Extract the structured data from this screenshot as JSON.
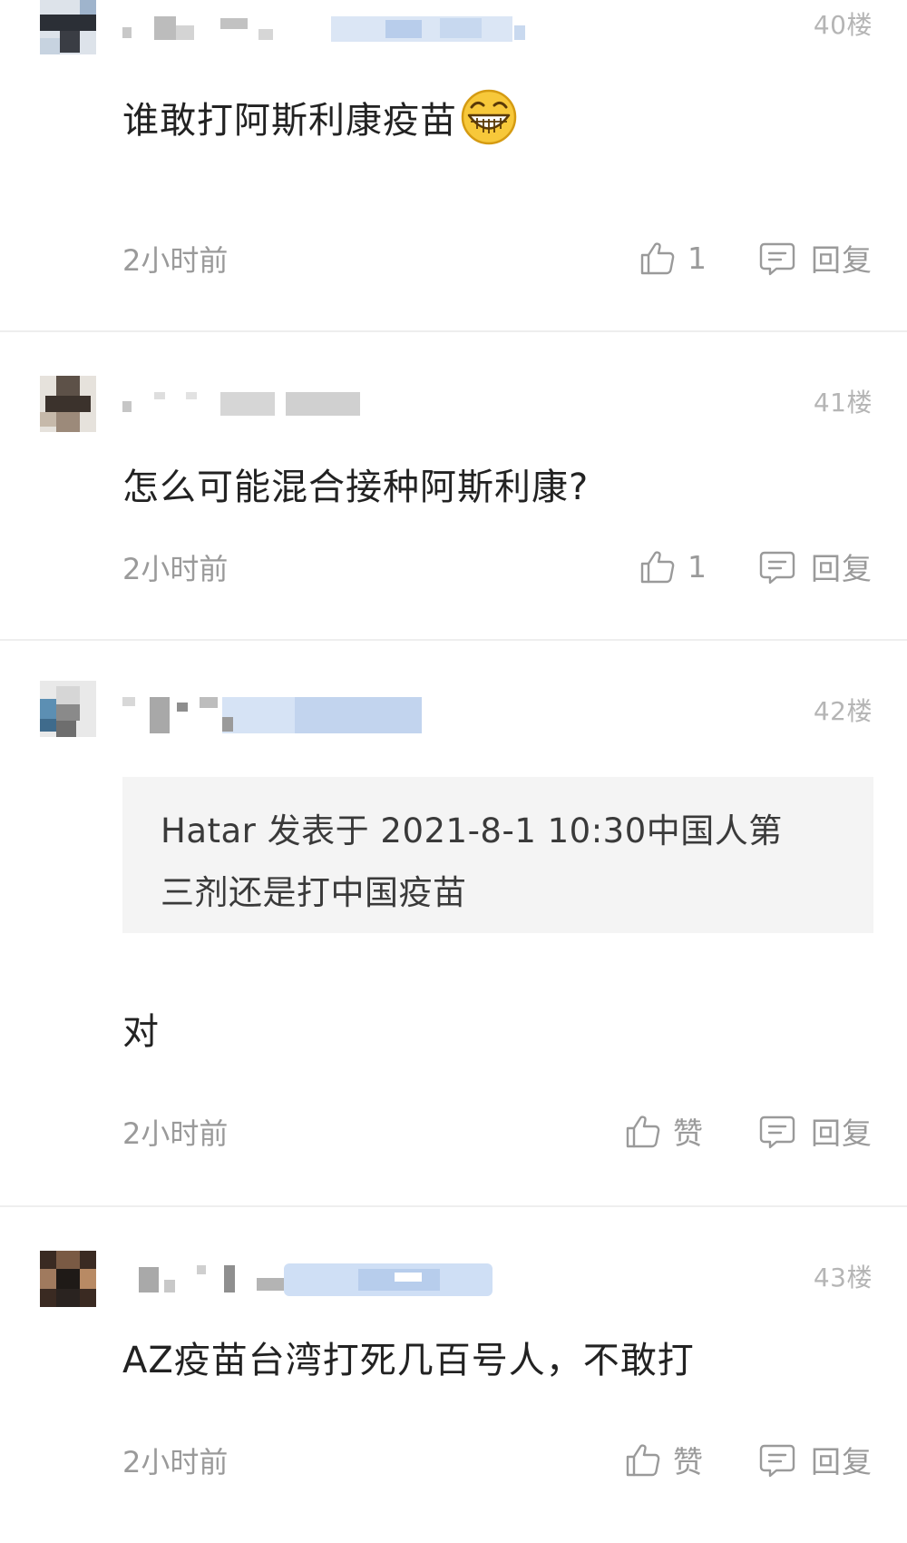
{
  "comments": [
    {
      "floor": "40楼",
      "text": "谁敢打阿斯利康疫苗",
      "emoji": "grinning-face-emoji",
      "time": "2小时前",
      "likes": "1",
      "reply_label": "回复"
    },
    {
      "floor": "41楼",
      "text": "怎么可能混合接种阿斯利康?",
      "time": "2小时前",
      "likes": "1",
      "reply_label": "回复"
    },
    {
      "floor": "42楼",
      "quote_line1": "Hatar 发表于 2021-8-1 10:30中国人第",
      "quote_line2": "三剂还是打中国疫苗",
      "text": "对",
      "time": "2小时前",
      "likes": "赞",
      "reply_label": "回复"
    },
    {
      "floor": "43楼",
      "text": "AZ疫苗台湾打死几百号人，不敢打",
      "time": "2小时前",
      "likes": "赞",
      "reply_label": "回复"
    }
  ],
  "icons": {
    "like": "thumbs-up-icon",
    "reply": "comment-bubble-icon"
  },
  "colors": {
    "muted_text": "#9a9a9a",
    "floor_text": "#b5b5b5",
    "quote_bg": "#f4f4f4",
    "divider": "#eeeeee"
  }
}
